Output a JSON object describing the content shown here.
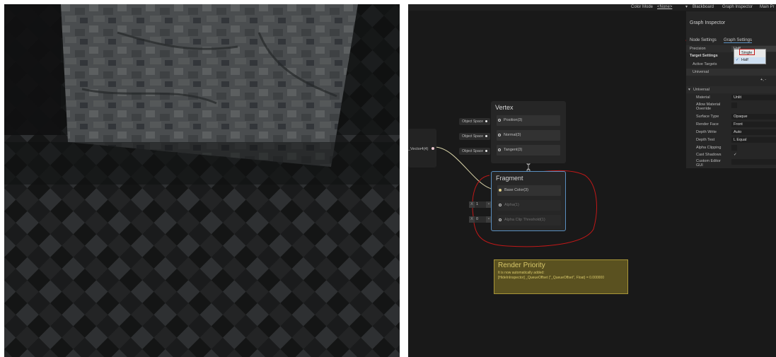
{
  "colors": {
    "accent_blue": "#5a8fbf",
    "annotation_red": "#c01818",
    "note_yellow": "#5a5120",
    "wire": "#d8d2a8"
  },
  "top_bar": {
    "color_mode_label": "Color Mode",
    "color_mode_value": "<None>",
    "blackboard": "Blackboard",
    "graph_inspector": "Graph Inspector",
    "main_preview": "Main Pr"
  },
  "inspector": {
    "title": "Graph Inspector",
    "tabs": [
      "Node Settings",
      "Graph Settings"
    ],
    "precision": {
      "label": "Precision",
      "value": "Half"
    },
    "dropdown_options": [
      "Single",
      "Half"
    ],
    "selected_option": "Half",
    "target_settings_label": "Target Settings",
    "active_targets_label": "Active Targets",
    "universal_item": "Universal",
    "add_remove": "+, -",
    "universal_section": "Universal",
    "props": [
      {
        "label": "Material",
        "value": "Unlit"
      },
      {
        "label": "Allow Material Override",
        "value": ""
      },
      {
        "label": "Surface Type",
        "value": "Opaque"
      },
      {
        "label": "Render Face",
        "value": "Front"
      },
      {
        "label": "Depth Write",
        "value": "Auto"
      },
      {
        "label": "Depth Test",
        "value": "L Equal"
      },
      {
        "label": "Alpha Clipping",
        "value": ""
      },
      {
        "label": "Cast Shadows",
        "value": "✓"
      },
      {
        "label": "Custom Editor GUI",
        "value": ""
      }
    ]
  },
  "vertex_node": {
    "title": "Vertex",
    "ports": [
      "Position(3)",
      "Normal(3)",
      "Tangent(3)"
    ],
    "inputs": [
      "Object Space",
      "Object Space",
      "Object Space"
    ]
  },
  "fragment_node": {
    "title": "Fragment",
    "ports": [
      "Base Color(3)",
      "Alpha(1)",
      "Alpha Clip Threshold(1)"
    ],
    "inputs": [
      {
        "x": "X",
        "v": "1"
      },
      {
        "x": "X",
        "v": "0"
      }
    ]
  },
  "source_node": {
    "output": "_Vector4(4)"
  },
  "note": {
    "title": "Render Priority",
    "line1": "It is now automatically added:",
    "line2": "[HideInInspector] _QueueOffset (\"_QueueOffset\", Float) = 0.000000"
  }
}
